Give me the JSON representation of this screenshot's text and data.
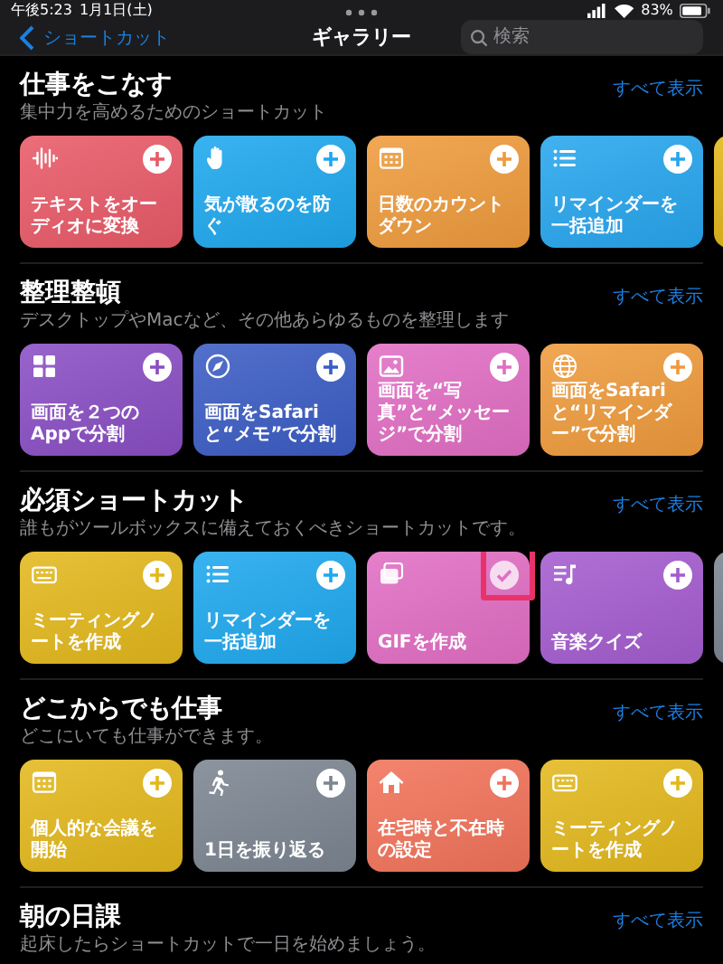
{
  "status_bar": {
    "time": "午後5:23",
    "date": "1月1日(土)",
    "battery": "83%"
  },
  "nav": {
    "back": "ショートカット",
    "title": "ギャラリー",
    "search": {
      "placeholder": "検索"
    }
  },
  "sections": [
    {
      "title": "仕事をこなす",
      "subtitle": "集中力を高めるためのショートカット",
      "see_all": "すべて表示",
      "cards": [
        {
          "title": "テキストをオーディオに変換",
          "kind": "wave",
          "color": "#e95a68",
          "added": false
        },
        {
          "title": "気が散るのを防ぐ",
          "kind": "hand",
          "color": "#1ea8ee",
          "added": false
        },
        {
          "title": "日数のカウントダウン",
          "kind": "calendar",
          "color": "#ef9b3c",
          "added": false
        },
        {
          "title": "リマインダーを一括追加",
          "kind": "list",
          "color": "#27a6ee",
          "added": false
        },
        {
          "kind": "peek",
          "color": "#e3b81c"
        }
      ]
    },
    {
      "title": "整理整頓",
      "subtitle": "デスクトップやMacなど、その他あらゆるものを整理します",
      "see_all": "すべて表示",
      "cards": [
        {
          "title": "画面を２つのAppで分割",
          "kind": "grid",
          "color": "#8a4ec4",
          "added": false
        },
        {
          "title": "画面をSafariと“メモ”で分割",
          "kind": "compass",
          "color": "#3b5cc4",
          "added": false
        },
        {
          "title": "画面を“写真”と“メッセージ”で分割",
          "kind": "photo",
          "color": "#e26ec4",
          "added": false
        },
        {
          "title": "画面をSafariと“リマインダー”で分割",
          "kind": "globe",
          "color": "#ef9b3c",
          "added": false
        }
      ]
    },
    {
      "title": "必須ショートカット",
      "subtitle": "誰もがツールボックスに備えておくべきショートカットです。",
      "see_all": "すべて表示",
      "cards": [
        {
          "title": "ミーティングノートを作成",
          "kind": "keyboard",
          "color": "#e3b81c",
          "added": false
        },
        {
          "title": "リマインダーを一括追加",
          "kind": "list",
          "color": "#1ea8ee",
          "added": false
        },
        {
          "title": "GIFを作成",
          "kind": "photos",
          "color": "#e26ec4",
          "added": true,
          "highlighted": true
        },
        {
          "title": "音楽クイズ",
          "kind": "music",
          "color": "#a45ccf",
          "added": false
        },
        {
          "kind": "peek",
          "color": "#7c8691"
        }
      ]
    },
    {
      "title": "どこからでも仕事",
      "subtitle": "どこにいても仕事ができます。",
      "see_all": "すべて表示",
      "cards": [
        {
          "title": "個人的な会議を開始",
          "kind": "calendar",
          "color": "#e3b81c",
          "added": false
        },
        {
          "title": "1日を振り返る",
          "kind": "runner",
          "color": "#7c8691",
          "added": false
        },
        {
          "title": "在宅時と不在時の設定",
          "kind": "house",
          "color": "#f2735a",
          "added": false
        },
        {
          "title": "ミーティングノートを作成",
          "kind": "keyboard",
          "color": "#e3b81c",
          "added": false
        }
      ]
    },
    {
      "title": "朝の日課",
      "subtitle": "起床したらショートカットで一日を始めましょう。",
      "see_all": "すべて表示"
    }
  ]
}
